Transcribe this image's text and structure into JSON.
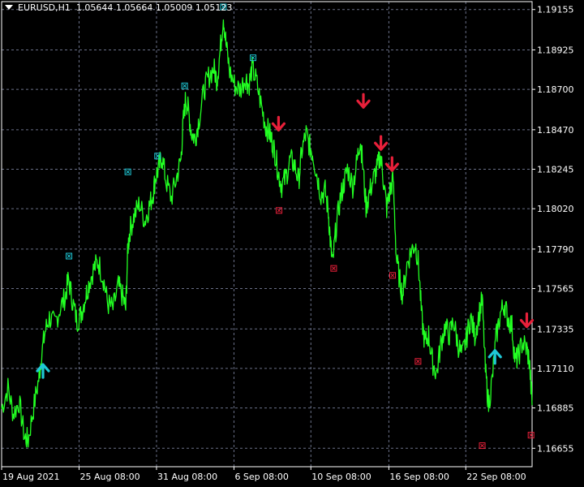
{
  "header": {
    "symbol": "EURUSD,H1",
    "ohlc": "1.05644 1.05664 1.05009 1.05123"
  },
  "colors": {
    "background": "#000000",
    "price_line": "#22ff22",
    "grid": "#6a7088",
    "axis": "#ffffff",
    "buy_arrow": "#1fc8d6",
    "sell_arrow": "#e8203a",
    "swing_high_marker": "#1fc8d6",
    "swing_low_marker": "#e8203a"
  },
  "chart_data": {
    "type": "line",
    "title": "",
    "xlabel": "",
    "ylabel": "",
    "ylim": [
      1.1655,
      1.192
    ],
    "xlim": [
      0,
      100
    ],
    "grid": true,
    "y_ticks": [
      "1.19155",
      "1.18925",
      "1.18700",
      "1.18470",
      "1.18245",
      "1.18020",
      "1.17790",
      "1.17565",
      "1.17335",
      "1.17110",
      "1.16885",
      "1.16655"
    ],
    "x_ticks": [
      {
        "label": "19 Aug 2021",
        "x": 0
      },
      {
        "label": "25 Aug 08:00",
        "x": 14.6
      },
      {
        "label": "31 Aug 08:00",
        "x": 29.2
      },
      {
        "label": "6 Sep 08:00",
        "x": 43.8
      },
      {
        "label": "10 Sep 08:00",
        "x": 58.3
      },
      {
        "label": "16 Sep 08:00",
        "x": 73.0
      },
      {
        "label": "22 Sep 08:00",
        "x": 87.5
      }
    ],
    "series": [
      {
        "values": [
          [
            0,
            1.1688
          ],
          [
            1.2,
            1.17
          ],
          [
            2.2,
            1.1685
          ],
          [
            3.3,
            1.1692
          ],
          [
            4.3,
            1.1672
          ],
          [
            5,
            1.167
          ],
          [
            6,
            1.1688
          ],
          [
            7,
            1.1705
          ],
          [
            7.5,
            1.1718
          ],
          [
            8.2,
            1.1732
          ],
          [
            9,
            1.174
          ],
          [
            10,
            1.1736
          ],
          [
            11,
            1.1745
          ],
          [
            12,
            1.1752
          ],
          [
            12.6,
            1.1762
          ],
          [
            13.4,
            1.1749
          ],
          [
            14.2,
            1.1738
          ],
          [
            15,
            1.1742
          ],
          [
            15.8,
            1.1752
          ],
          [
            16.5,
            1.176
          ],
          [
            17.4,
            1.1768
          ],
          [
            18.2,
            1.1772
          ],
          [
            19.2,
            1.1762
          ],
          [
            20,
            1.1748
          ],
          [
            21,
            1.1745
          ],
          [
            22,
            1.1758
          ],
          [
            22.8,
            1.1752
          ],
          [
            23.4,
            1.1745
          ],
          [
            23.8,
            1.178
          ],
          [
            24.2,
            1.179
          ],
          [
            25,
            1.1798
          ],
          [
            26,
            1.1805
          ],
          [
            27,
            1.1795
          ],
          [
            27.8,
            1.1803
          ],
          [
            28.5,
            1.181
          ],
          [
            29,
            1.182
          ],
          [
            29.6,
            1.1825
          ],
          [
            30.2,
            1.1832
          ],
          [
            31,
            1.1818
          ],
          [
            32,
            1.1808
          ],
          [
            33,
            1.182
          ],
          [
            33.8,
            1.183
          ],
          [
            34.2,
            1.185
          ],
          [
            34.7,
            1.1865
          ],
          [
            35.2,
            1.1858
          ],
          [
            35.8,
            1.1845
          ],
          [
            36.5,
            1.1842
          ],
          [
            37.2,
            1.1853
          ],
          [
            38.2,
            1.187
          ],
          [
            39,
            1.1877
          ],
          [
            40,
            1.1882
          ],
          [
            40.6,
            1.1875
          ],
          [
            41.2,
            1.1892
          ],
          [
            41.8,
            1.1912
          ],
          [
            42.3,
            1.1896
          ],
          [
            43,
            1.188
          ],
          [
            44,
            1.1872
          ],
          [
            45,
            1.187
          ],
          [
            46,
            1.1877
          ],
          [
            46.6,
            1.1872
          ],
          [
            47.2,
            1.1882
          ],
          [
            48,
            1.1875
          ],
          [
            49,
            1.186
          ],
          [
            49.8,
            1.1849
          ],
          [
            50.5,
            1.1845
          ],
          [
            51,
            1.184
          ],
          [
            51.6,
            1.1833
          ],
          [
            52.2,
            1.1822
          ],
          [
            52.8,
            1.1815
          ],
          [
            53.6,
            1.182
          ],
          [
            54.4,
            1.183
          ],
          [
            55.2,
            1.1827
          ],
          [
            56,
            1.1818
          ],
          [
            56.6,
            1.1835
          ],
          [
            57.4,
            1.1845
          ],
          [
            58,
            1.1838
          ],
          [
            58.6,
            1.1834
          ],
          [
            59.4,
            1.1822
          ],
          [
            60.2,
            1.181
          ],
          [
            61,
            1.1812
          ],
          [
            61.6,
            1.18
          ],
          [
            62,
            1.1782
          ],
          [
            62.4,
            1.177
          ],
          [
            63,
            1.179
          ],
          [
            63.8,
            1.1807
          ],
          [
            64.5,
            1.1816
          ],
          [
            65.2,
            1.1825
          ],
          [
            66.2,
            1.1815
          ],
          [
            67,
            1.1829
          ],
          [
            67.6,
            1.1842
          ],
          [
            68,
            1.183
          ],
          [
            68.7,
            1.1803
          ],
          [
            69.4,
            1.1812
          ],
          [
            70.2,
            1.182
          ],
          [
            70.8,
            1.1825
          ],
          [
            71.4,
            1.1833
          ],
          [
            72,
            1.1818
          ],
          [
            72.6,
            1.1802
          ],
          [
            73.2,
            1.1812
          ],
          [
            73.8,
            1.1819
          ],
          [
            74.4,
            1.1775
          ],
          [
            75,
            1.1762
          ],
          [
            75.6,
            1.1753
          ],
          [
            76.4,
            1.177
          ],
          [
            77.2,
            1.1778
          ],
          [
            78,
            1.1782
          ],
          [
            78.6,
            1.177
          ],
          [
            79.2,
            1.174
          ],
          [
            79.8,
            1.1725
          ],
          [
            80.5,
            1.173
          ],
          [
            81.2,
            1.1715
          ],
          [
            82,
            1.1708
          ],
          [
            82.8,
            1.1725
          ],
          [
            83.6,
            1.1735
          ],
          [
            84.4,
            1.173
          ],
          [
            85.2,
            1.1738
          ],
          [
            86,
            1.1725
          ],
          [
            86.8,
            1.1718
          ],
          [
            87.6,
            1.1728
          ],
          [
            88.4,
            1.174
          ],
          [
            89.2,
            1.173
          ],
          [
            90,
            1.1742
          ],
          [
            90.6,
            1.175
          ],
          [
            91.2,
            1.171
          ],
          [
            91.8,
            1.169
          ],
          [
            92.5,
            1.1705
          ],
          [
            93.2,
            1.1728
          ],
          [
            94,
            1.1742
          ],
          [
            94.8,
            1.1748
          ],
          [
            95.4,
            1.174
          ],
          [
            96.2,
            1.1735
          ],
          [
            96.8,
            1.1715
          ],
          [
            97.4,
            1.1718
          ],
          [
            98.2,
            1.1726
          ],
          [
            99,
            1.1722
          ],
          [
            99.5,
            1.1715
          ],
          [
            100,
            1.169
          ]
        ]
      }
    ],
    "buy_arrows": [
      [
        7.8,
        1.171
      ],
      [
        93.0,
        1.1718
      ]
    ],
    "sell_arrows": [
      [
        52.2,
        1.185
      ],
      [
        68.2,
        1.1863
      ],
      [
        71.5,
        1.1839
      ],
      [
        73.6,
        1.1827
      ],
      [
        99.0,
        1.1738
      ]
    ],
    "swing_high_markers": [
      [
        12.7,
        1.1775
      ],
      [
        23.8,
        1.1823
      ],
      [
        29.4,
        1.1832
      ],
      [
        34.5,
        1.1872
      ],
      [
        41.8,
        1.1917
      ],
      [
        47.4,
        1.1888
      ]
    ],
    "swing_low_markers": [
      [
        52.3,
        1.1801
      ],
      [
        62.6,
        1.1768
      ],
      [
        73.7,
        1.1764
      ],
      [
        78.5,
        1.1715
      ],
      [
        90.6,
        1.1667
      ],
      [
        99.8,
        1.1673
      ]
    ]
  }
}
